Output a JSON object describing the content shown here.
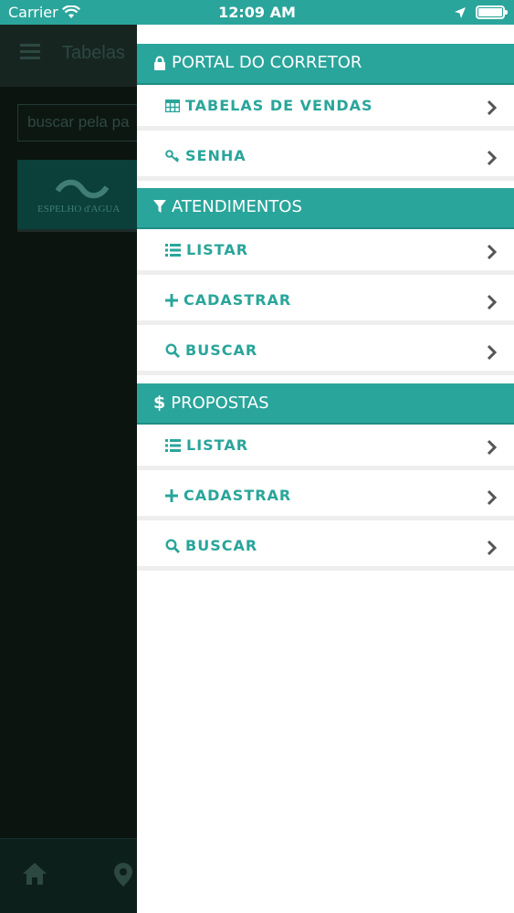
{
  "status_bar": {
    "carrier": "Carrier",
    "time": "12:09 AM",
    "icons": [
      "wifi-icon",
      "location-arrow-icon",
      "battery-icon"
    ]
  },
  "background": {
    "header_title": "Tabelas",
    "search_placeholder": "buscar pela pa",
    "card_text": "ESPELHO d'AGUA"
  },
  "drawer": {
    "sections": [
      {
        "label": "PORTAL DO CORRETOR",
        "icon": "lock-icon",
        "items": [
          {
            "label": "TABELAS DE VENDAS",
            "icon": "table-icon"
          },
          {
            "label": "SENHA",
            "icon": "key-icon"
          }
        ]
      },
      {
        "label": "ATENDIMENTOS",
        "icon": "filter-icon",
        "items": [
          {
            "label": "LISTAR",
            "icon": "list-icon"
          },
          {
            "label": "CADASTRAR",
            "icon": "plus-icon"
          },
          {
            "label": "BUSCAR",
            "icon": "search-icon"
          }
        ]
      },
      {
        "label": "PROPOSTAS",
        "icon": "dollar-icon",
        "items": [
          {
            "label": "LISTAR",
            "icon": "list-icon"
          },
          {
            "label": "CADASTRAR",
            "icon": "plus-icon"
          },
          {
            "label": "BUSCAR",
            "icon": "search-icon"
          }
        ]
      }
    ]
  },
  "colors": {
    "accent": "#2aa59b",
    "row_divider": "#eeeeee",
    "chevron": "#555555"
  }
}
